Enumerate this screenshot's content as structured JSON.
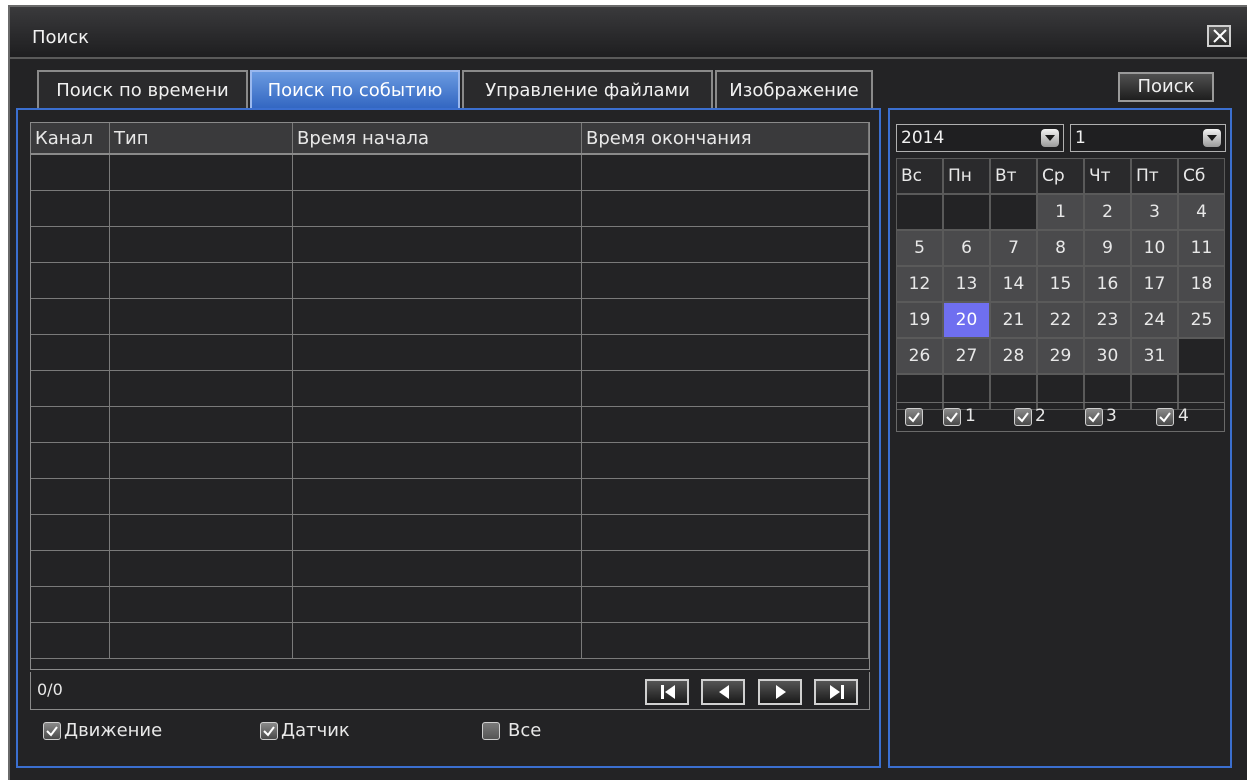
{
  "window": {
    "title": "Поиск"
  },
  "tabs": [
    {
      "label": "Поиск по времени"
    },
    {
      "label": "Поиск по событию"
    },
    {
      "label": "Управление файлами"
    },
    {
      "label": "Изображение"
    }
  ],
  "search_button": "Поиск",
  "table": {
    "headers": [
      "Канал",
      "Тип",
      "Время начала",
      "Время окончания"
    ]
  },
  "page_counter": "0/0",
  "filters": {
    "motion": {
      "label": "Движение",
      "checked": true
    },
    "sensor": {
      "label": "Датчик",
      "checked": true
    },
    "all": {
      "label": "Все",
      "checked": false
    }
  },
  "calendar": {
    "year": "2014",
    "month": "1",
    "weekdays": [
      "Вс",
      "Пн",
      "Вт",
      "Ср",
      "Чт",
      "Пт",
      "Сб"
    ],
    "weeks": [
      [
        "",
        "",
        "",
        "1",
        "2",
        "3",
        "4"
      ],
      [
        "5",
        "6",
        "7",
        "8",
        "9",
        "10",
        "11"
      ],
      [
        "12",
        "13",
        "14",
        "15",
        "16",
        "17",
        "18"
      ],
      [
        "19",
        "20",
        "21",
        "22",
        "23",
        "24",
        "25"
      ],
      [
        "26",
        "27",
        "28",
        "29",
        "30",
        "31",
        ""
      ],
      [
        "",
        "",
        "",
        "",
        "",
        "",
        ""
      ]
    ],
    "selected_day": "20"
  },
  "channels": {
    "labels": [
      "1",
      "2",
      "3",
      "4"
    ]
  },
  "colors": {
    "accent": "#3b6fd0",
    "selected_day": "#6f6ff0",
    "active_tab": "#3064c0"
  },
  "icons": {
    "close": "close-icon",
    "first": "first-page-icon",
    "prev": "prev-page-icon",
    "next": "next-page-icon",
    "last": "last-page-icon",
    "dropdown": "chevron-down-icon",
    "check": "check-icon"
  }
}
